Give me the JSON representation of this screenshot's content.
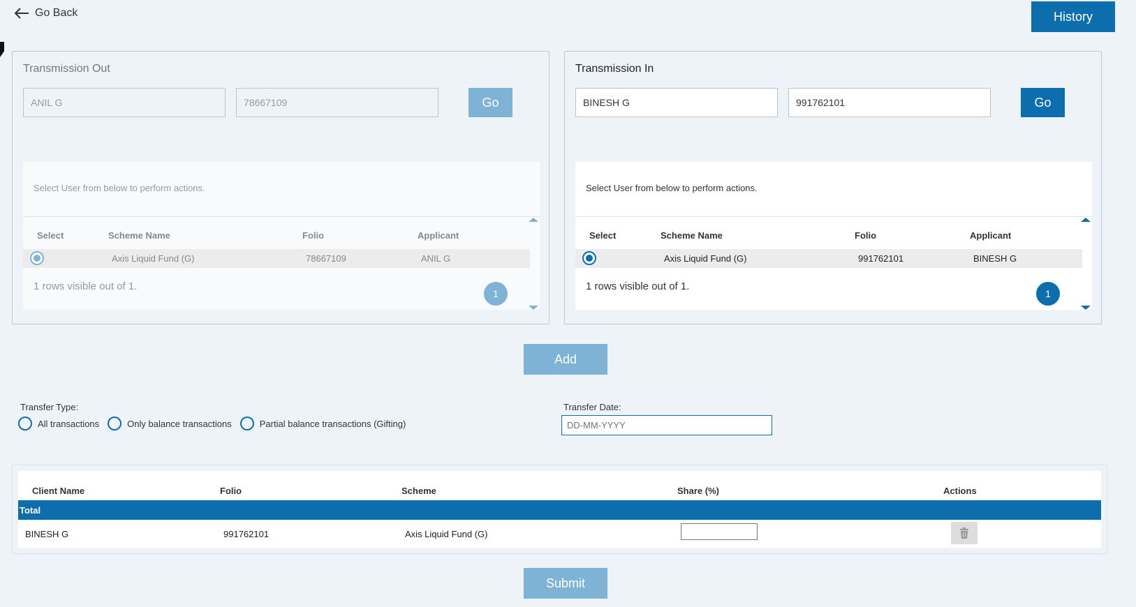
{
  "nav": {
    "go_back": "Go Back"
  },
  "header": {
    "history_label": "History"
  },
  "transmission_out": {
    "title": "Transmission Out",
    "name_value": "ANIL G",
    "folio_value": "78667109",
    "go_label": "Go",
    "hint": "Select User from below to perform actions.",
    "columns": [
      "Select",
      "Scheme Name",
      "Folio",
      "Applicant"
    ],
    "row": {
      "scheme": "Axis Liquid Fund (G)",
      "folio": "78667109",
      "applicant": "ANIL G"
    },
    "rows_visible": "1  rows visible out of 1.",
    "page": "1"
  },
  "transmission_in": {
    "title": "Transmission In",
    "name_value": "BINESH G",
    "folio_value": "991762101",
    "go_label": "Go",
    "hint": "Select User from below to perform actions.",
    "columns": [
      "Select",
      "Scheme Name",
      "Folio",
      "Applicant"
    ],
    "row": {
      "scheme": "Axis Liquid Fund (G)",
      "folio": "991762101",
      "applicant": "BINESH G"
    },
    "rows_visible": "1  rows visible out of 1.",
    "page": "1"
  },
  "add_label": "Add",
  "transfer": {
    "type_label": "Transfer Type:",
    "options": [
      "All transactions",
      "Only balance transactions",
      "Partial balance transactions (Gifting)"
    ],
    "date_label": "Transfer Date:",
    "date_placeholder": "DD-MM-YYYY"
  },
  "grid": {
    "columns": [
      "Client Name",
      "Folio",
      "Scheme",
      "Share (%)",
      "Actions"
    ],
    "total_label": "Total",
    "row": {
      "client": "BINESH G",
      "folio": "991762101",
      "scheme": "Axis Liquid Fund (G)"
    }
  },
  "submit_label": "Submit",
  "colors": {
    "primary": "#0d6eae",
    "primary_disabled": "#7fb3d6",
    "background": "#eef3f8"
  },
  "icons": {
    "back": "arrow-left-icon",
    "delete": "trash-icon"
  }
}
